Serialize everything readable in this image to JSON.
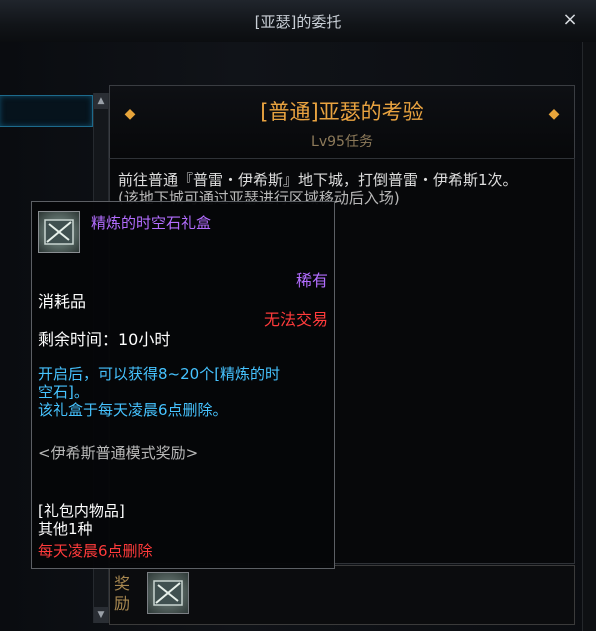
{
  "window": {
    "title": "[亚瑟]的委托",
    "close_label": "×"
  },
  "quest": {
    "name": "[普通]亚瑟的考验",
    "level": "Lv95任务",
    "description": "前往普通『普雷・伊希斯』地下城，打倒普雷・伊希斯1次。",
    "description_hint": "(该地下城可通过亚瑟进行区域移动后入场)"
  },
  "reward": {
    "label": "奖励"
  },
  "tooltip": {
    "item_name": "精炼的时空石礼盒",
    "rarity": "稀有",
    "item_type": "消耗品",
    "trade_status": "无法交易",
    "remaining_time": "剩余时间：10小时",
    "effect_line1": "开启后，可以获得8~20个[精炼的时",
    "effect_line2": "空石]。",
    "effect_line3": "该礼盒于每天凌晨6点删除。",
    "mode_reward": "<伊希斯普通模式奖励>",
    "pack_header": "[礼包内物品]",
    "pack_count": "其他1种",
    "delete_note": "每天凌晨6点删除"
  },
  "colors": {
    "accent_gold": "#e9a340",
    "rare_purple": "#b36dff",
    "warning_red": "#ff3b3b",
    "info_blue": "#46c3ff"
  },
  "icons": {
    "close": "close-icon",
    "item": "time-stone-box-icon",
    "diamond": "diamond-icon"
  }
}
